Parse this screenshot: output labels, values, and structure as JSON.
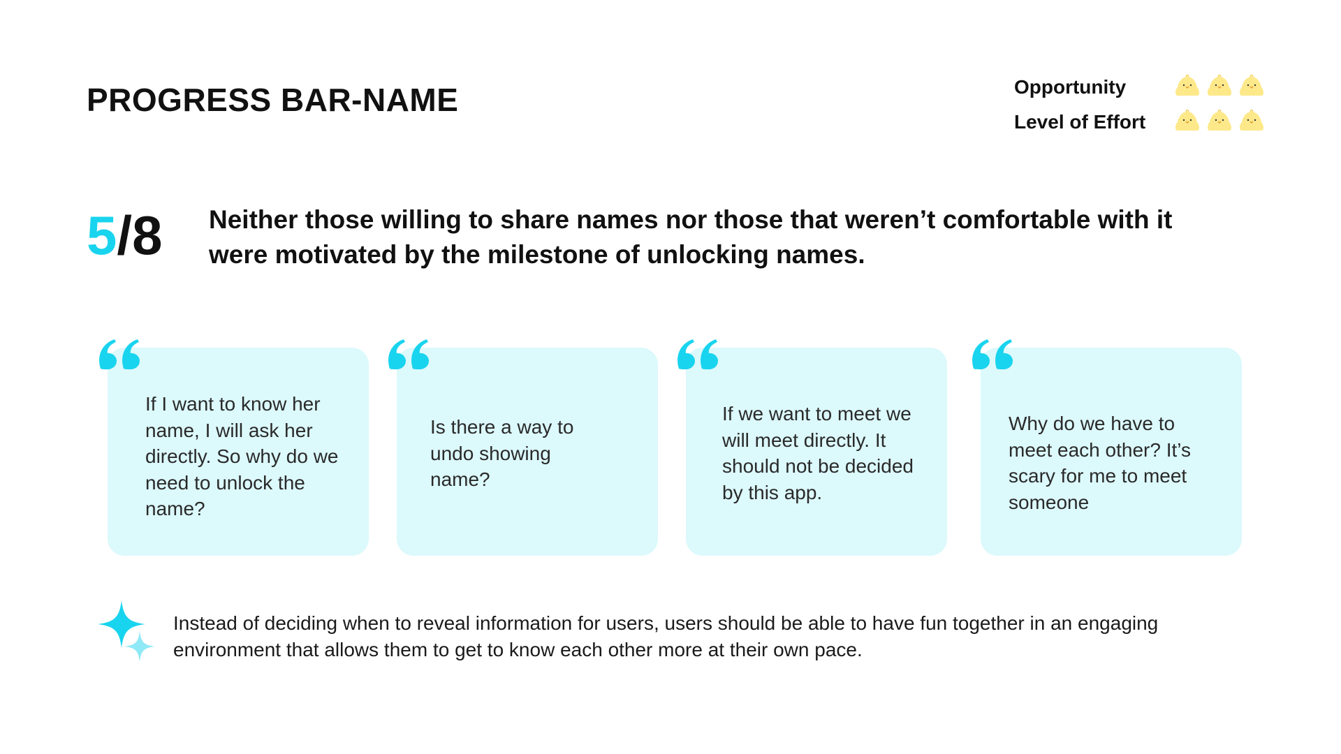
{
  "title": "PROGRESS BAR-NAME",
  "ratings": [
    {
      "label": "Opportunity",
      "icon": "chick-icon",
      "count": 3
    },
    {
      "label": "Level of Effort",
      "icon": "chick-icon",
      "count": 3
    }
  ],
  "stat": {
    "numerator": "5",
    "separator": "/",
    "denominator": "8"
  },
  "headline": "Neither those willing to share names nor those that weren’t comfortable with it were motivated by the milestone of unlocking names.",
  "quotes": [
    "If I want to know her name, I will ask her directly. So why do we need to unlock the name?",
    "Is there a way to undo showing name?",
    "If we want to meet we will meet directly. It should not be decided by this app.",
    "Why do we have to meet each other? It’s scary for me to meet someone"
  ],
  "insight": {
    "icon": "sparkle-icon",
    "text": "Instead of deciding when to reveal information for users, users should be able to have fun together in an engaging environment that allows them to get to know each other more at their own pace."
  },
  "colors": {
    "accent": "#19d4ee",
    "card_bg": "#dcf9fc",
    "chick": "#fde98a"
  }
}
